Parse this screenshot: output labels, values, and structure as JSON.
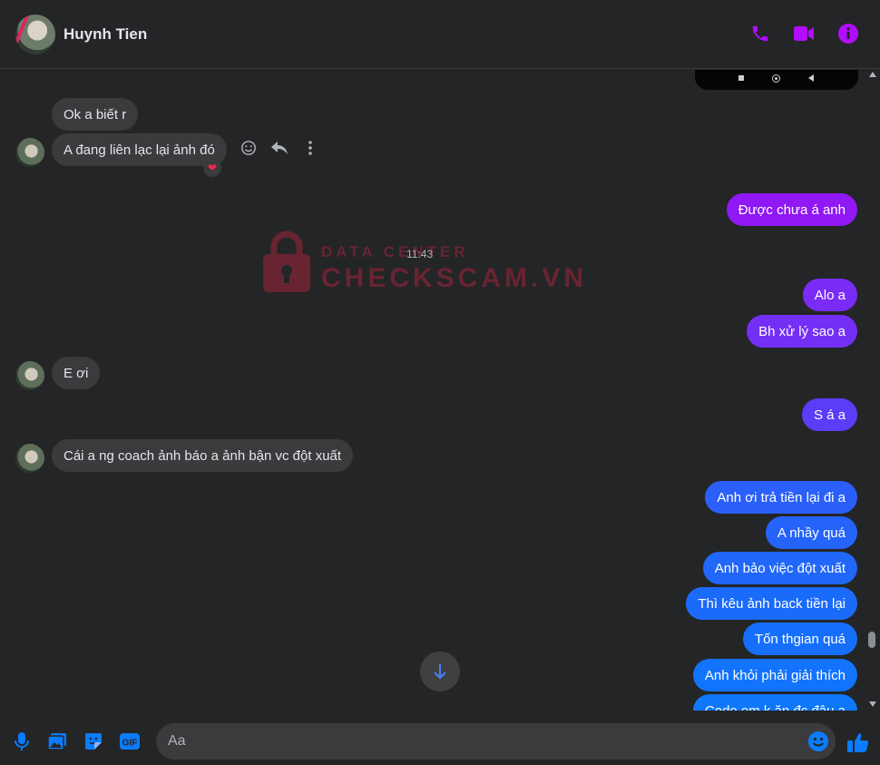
{
  "contact": {
    "name": "Huynh Tien"
  },
  "header_icons": [
    "phone-icon",
    "video-camera-icon",
    "info-icon"
  ],
  "colors": {
    "accent": "#b20cff",
    "messenger_blue": "#0a7cff",
    "bubble_purple": "#7a2cf6",
    "bubble_in": "#3a3b3c",
    "background": "#242526",
    "watermark": "#a0243a"
  },
  "timestamp": "11:43",
  "watermark": {
    "line1": "DATA CENTER",
    "line2": "CHECKSCAM.VN"
  },
  "messages": {
    "in_1": "Ok a biết r",
    "in_2": "A đang liên lạc lại ảnh đó",
    "in_2_reaction": "❤",
    "out_1": "Được chưa á anh",
    "out_2": "Alo a",
    "out_3": "Bh xử lý sao a",
    "in_3": "E ơi",
    "out_4": "S á a",
    "in_4": "Cái a ng coach ảnh báo a ảnh bận vc đột xuất",
    "out_5": "Anh ơi trả tiền lại đi a",
    "out_6": "A nhầy quá",
    "out_7": "Anh bảo việc đột xuất",
    "out_8": "Thì kêu ảnh back tiền lại",
    "out_9": "Tốn thgian quá",
    "out_10": "Anh khỏi phải giải thích",
    "out_11": "Code em k ăn đc đâu a"
  },
  "message_tools": [
    "smile-icon",
    "reply-icon",
    "more-icon"
  ],
  "composer": {
    "placeholder": "Aa",
    "value": "",
    "icons": [
      "microphone-icon",
      "image-icon",
      "sticker-icon",
      "gif-icon",
      "emoji-icon",
      "thumbs-up-icon"
    ],
    "gif_label": "GIF"
  }
}
